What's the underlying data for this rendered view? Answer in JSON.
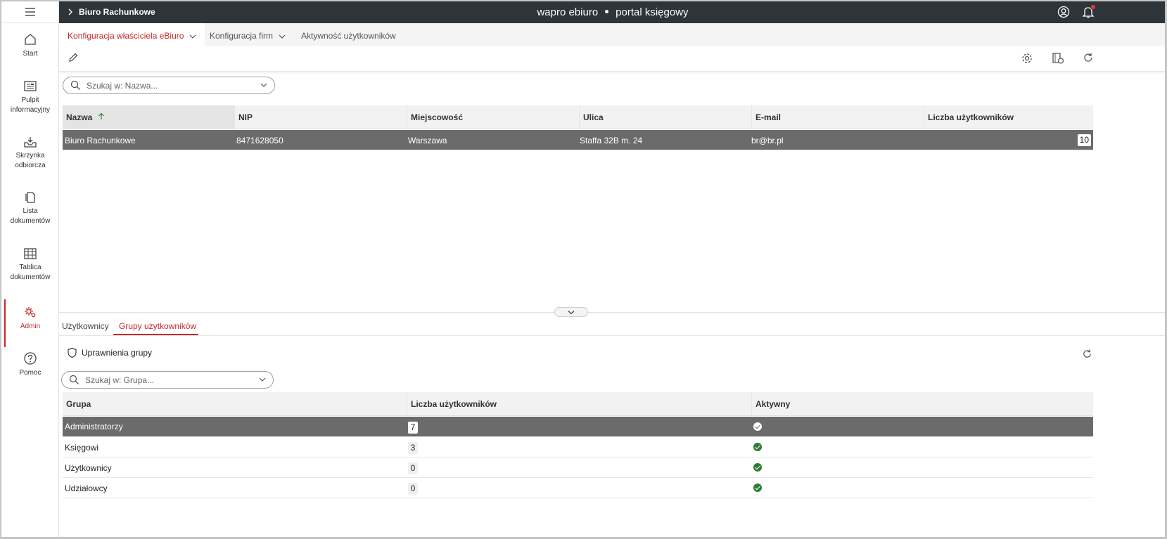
{
  "header": {
    "breadcrumb": "Biuro Rachunkowe",
    "brand_left": "wapro ebiuro",
    "brand_right": "portal księgowy",
    "icons": [
      "user-circle-icon",
      "bell-icon"
    ]
  },
  "sidebar": {
    "menu_icon": "hamburger-icon",
    "items": [
      {
        "label": "Start",
        "icon": "home-icon"
      },
      {
        "label": "Pulpit informacyjny",
        "icon": "newspaper-icon"
      },
      {
        "label": "Skrzynka odbiorcza",
        "icon": "inbox-icon"
      },
      {
        "label": "Lista dokumentów",
        "icon": "documents-icon"
      },
      {
        "label": "Tablica dokumentów",
        "icon": "table-icon"
      },
      {
        "label": "Admin",
        "icon": "admin-gear-icon",
        "active": true
      },
      {
        "label": "Pomoc",
        "icon": "help-icon"
      }
    ]
  },
  "tabs": [
    {
      "label": "Konfiguracja właściciela eBiuro",
      "active": true
    },
    {
      "label": "Konfiguracja firm"
    },
    {
      "label": "Aktywność użytkowników"
    }
  ],
  "toolbar": {
    "left_icons": [
      "edit-pencil-icon"
    ],
    "right_icons": [
      "settings-gear-icon",
      "book-help-icon",
      "refresh-icon"
    ]
  },
  "office_search": {
    "placeholder": "Szukaj w: Nazwa..."
  },
  "office_grid": {
    "columns": [
      "Nazwa",
      "NIP",
      "Miejscowość",
      "Ulica",
      "E-mail",
      "Liczba użytkowników"
    ],
    "sort_column": "Nazwa",
    "rows": [
      {
        "nazwa": "Biuro Rachunkowe",
        "nip": "8471628050",
        "miejscowosc": "Warszawa",
        "ulica": "Staffa 32B m. 24",
        "email": "br@br.pl",
        "liczba": "10"
      }
    ]
  },
  "bottom_tabs": [
    {
      "label": "Użytkownicy"
    },
    {
      "label": "Grupy użytkowników",
      "active": true
    }
  ],
  "group_panel": {
    "permissions_label": "Uprawnienia grupy",
    "refresh_icon": "refresh-icon"
  },
  "group_search": {
    "placeholder": "Szukaj w: Grupa..."
  },
  "group_grid": {
    "columns": [
      "Grupa",
      "Liczba użytkowników",
      "Aktywny"
    ],
    "rows": [
      {
        "grupa": "Administratorzy",
        "liczba": "7",
        "aktywny": true
      },
      {
        "grupa": "Księgowi",
        "liczba": "3",
        "aktywny": true
      },
      {
        "grupa": "Użytkownicy",
        "liczba": "0",
        "aktywny": true
      },
      {
        "grupa": "Udziałowcy",
        "liczba": "0",
        "aktywny": true
      }
    ]
  },
  "colors": {
    "accent": "#c62828",
    "header_bg": "#2d343a",
    "selected_row": "#6b6b6b",
    "active_check": "#2e7d32"
  }
}
